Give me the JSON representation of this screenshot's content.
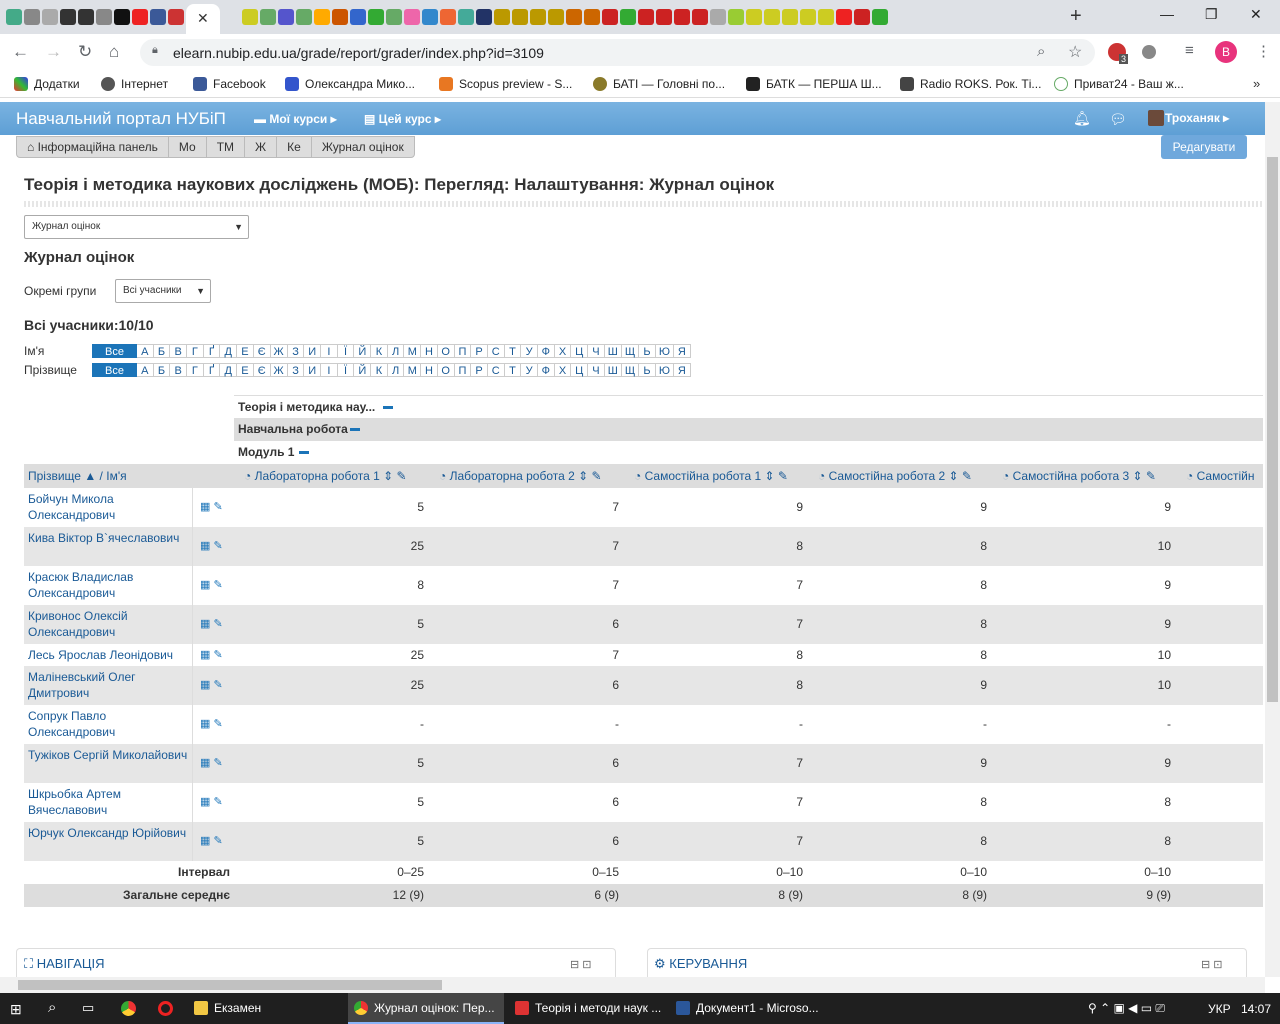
{
  "browser": {
    "url": "elearn.nubip.edu.ua/grade/report/grader/index.php?id=3109",
    "bookmarks": [
      "Додатки",
      "Інтернет",
      "Facebook",
      "Олександра Мико...",
      "Scopus preview - S...",
      "БАТІ — Головні по...",
      "БАТК — ПЕРША Ш...",
      "Radio ROKS. Рок. Ті...",
      "Приват24 - Ваш ж..."
    ],
    "profile_initial": "B",
    "ext_badge": "3"
  },
  "navbar": {
    "brand": "Навчальний портал НУБіП",
    "my_courses": "Мої курси",
    "this_course": "Цей курс",
    "user": "Троханяк"
  },
  "breadcrumb": [
    "Інформаційна панель",
    "Мо",
    "ТМ",
    "Ж",
    "Ке",
    "Журнал оцінок"
  ],
  "edit_button": "Редагувати",
  "page_title": "Теорія і методика наукових досліджень (МОБ): Перегляд: Налаштування: Журнал оцінок",
  "report_select": "Журнал оцінок",
  "report_heading": "Журнал оцінок",
  "groups": {
    "label": "Окремі групи",
    "value": "Всі учасники"
  },
  "all_participants": "Всі учасники:10/10",
  "initials": {
    "first_label": "Ім'я",
    "last_label": "Прізвище",
    "all": "Все",
    "letters": [
      "А",
      "Б",
      "В",
      "Г",
      "Ґ",
      "Д",
      "Е",
      "Є",
      "Ж",
      "З",
      "И",
      "І",
      "Ї",
      "Й",
      "К",
      "Л",
      "М",
      "Н",
      "О",
      "П",
      "Р",
      "С",
      "Т",
      "У",
      "Ф",
      "Х",
      "Ц",
      "Ч",
      "Ш",
      "Щ",
      "Ь",
      "Ю",
      "Я"
    ]
  },
  "categories": [
    "Теорія і методика нау...",
    "Навчальна робота",
    "Модуль 1"
  ],
  "grid": {
    "name_header_last": "Прізвище",
    "name_header_sep": "/",
    "name_header_first": "Ім'я",
    "columns": [
      "Лабораторна робота 1",
      "Лабораторна робота 2",
      "Самостійна робота 1",
      "Самостійна робота 2",
      "Самостійна робота 3",
      "Самостійн"
    ],
    "students": [
      {
        "name": "Бойчун Микола Олександрович",
        "grades": [
          "5",
          "7",
          "9",
          "9",
          "9"
        ]
      },
      {
        "name": "Кива Віктор В`ячеславович",
        "grades": [
          "25",
          "7",
          "8",
          "8",
          "10"
        ]
      },
      {
        "name": "Красюк Владислав Олександрович",
        "grades": [
          "8",
          "7",
          "7",
          "8",
          "9"
        ]
      },
      {
        "name": "Кривонос Олексій Олександрович",
        "grades": [
          "5",
          "6",
          "7",
          "8",
          "9"
        ]
      },
      {
        "name": "Лесь Ярослав Леонідович",
        "grades": [
          "25",
          "7",
          "8",
          "8",
          "10"
        ]
      },
      {
        "name": "Маліневський Олег Дмитрович",
        "grades": [
          "25",
          "6",
          "8",
          "9",
          "10"
        ]
      },
      {
        "name": "Сопрук Павло Олександрович",
        "grades": [
          "-",
          "-",
          "-",
          "-",
          "-"
        ]
      },
      {
        "name": "Тужіков Сергій Миколайович",
        "grades": [
          "5",
          "6",
          "7",
          "9",
          "9"
        ]
      },
      {
        "name": "Шкрьобка Артем Вячеславович",
        "grades": [
          "5",
          "6",
          "7",
          "8",
          "8"
        ]
      },
      {
        "name": "Юрчук Олександр Юрійович",
        "grades": [
          "5",
          "6",
          "7",
          "8",
          "8"
        ]
      }
    ],
    "range_label": "Інтервал",
    "ranges": [
      "0–25",
      "0–15",
      "0–10",
      "0–10",
      "0–10"
    ],
    "avg_label": "Загальне середнє",
    "averages": [
      "12 (9)",
      "6 (9)",
      "8 (9)",
      "8 (9)",
      "9 (9)"
    ]
  },
  "blocks": {
    "navigation": "НАВІГАЦІЯ",
    "administration": "КЕРУВАННЯ"
  },
  "taskbar": {
    "items": [
      "Екзамен",
      "Журнал оцінок: Пер...",
      "Теорія і методи наук ...",
      "Документ1 - Microso..."
    ],
    "lang": "УКР",
    "time": "14:07"
  },
  "colors": {
    "navbar": "#6fa8dc",
    "link": "#1a5a96",
    "accent": "#1b74b8"
  }
}
